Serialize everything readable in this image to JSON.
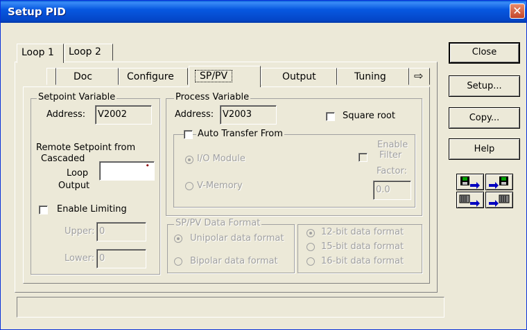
{
  "window": {
    "title": "Setup PID"
  },
  "loop_tabs": [
    "Loop 1",
    "Loop 2"
  ],
  "tabs": [
    "Doc",
    "Configure",
    "SP/PV",
    "Output",
    "Tuning"
  ],
  "active_tab": "SP/PV",
  "buttons": {
    "close": "Close",
    "setup": "Setup...",
    "copy": "Copy...",
    "help": "Help"
  },
  "setpoint": {
    "group_label": "Setpoint Variable",
    "address_label": "Address:",
    "address_value": "V2002",
    "remote_line1": "Remote Setpoint from",
    "remote_line2": "Cascaded",
    "remote_line3": "Loop",
    "remote_line4": "Output",
    "remote_value": "",
    "enable_limiting": "Enable Limiting",
    "upper_label": "Upper:",
    "upper_value": "0",
    "lower_label": "Lower:",
    "lower_value": "0"
  },
  "process": {
    "group_label": "Process Variable",
    "address_label": "Address:",
    "address_value": "V2003",
    "square_root": "Square root",
    "auto_transfer": "Auto Transfer From",
    "io_module": "I/O Module",
    "v_memory": "V-Memory",
    "enable_filter_1": "Enable",
    "enable_filter_2": "Filter",
    "enable_filter_3": "Factor:",
    "filter_value": "0.0"
  },
  "format": {
    "group_label": "SP/PV Data Format",
    "unipolar": "Unipolar data format",
    "bipolar": "Bipolar data format",
    "bit12": "12-bit data format",
    "bit15": "15-bit data format",
    "bit16": "16-bit data format"
  },
  "status": {
    "text": ""
  }
}
